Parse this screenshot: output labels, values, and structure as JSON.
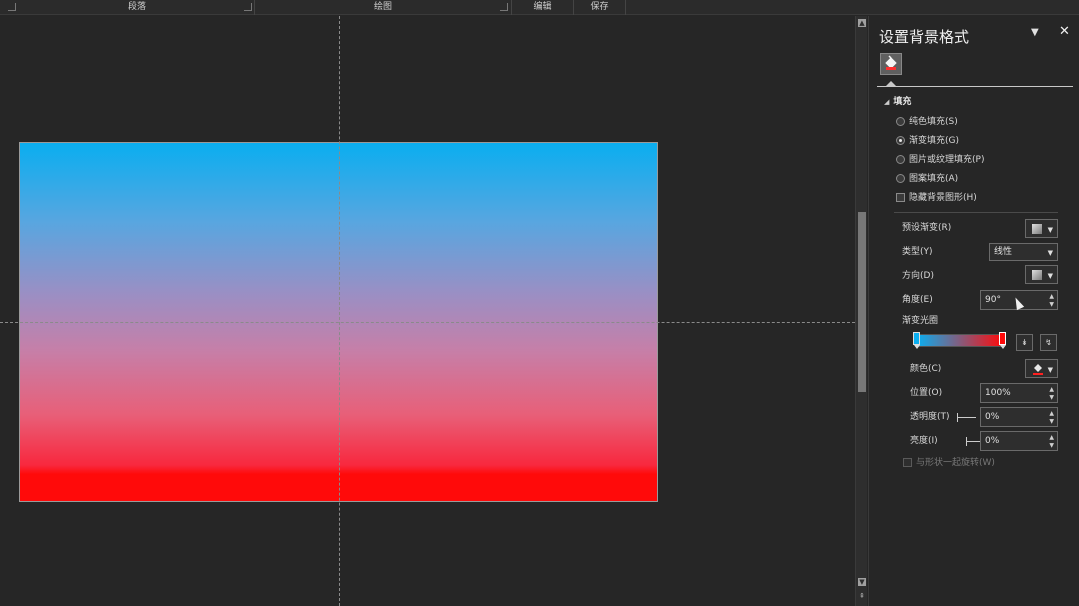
{
  "ribbon": {
    "groups": [
      "段落",
      "绘图",
      "编辑",
      "保存"
    ]
  },
  "pane": {
    "title": "设置背景格式",
    "menu_icon": "dropdown-arrow-icon",
    "close_icon": "close-icon",
    "tab_icon": "paint-bucket-icon",
    "section": "填充",
    "fill_options": [
      {
        "label": "纯色填充(S)",
        "selected": false
      },
      {
        "label": "渐变填充(G)",
        "selected": true
      },
      {
        "label": "图片或纹理填充(P)",
        "selected": false
      },
      {
        "label": "图案填充(A)",
        "selected": false
      }
    ],
    "hide_bg_graphics": "隐藏背景图形(H)",
    "preset_gradient": "预设渐变(R)",
    "type_label": "类型(Y)",
    "type_value": "线性",
    "direction_label": "方向(D)",
    "angle_label": "角度(E)",
    "angle_value": "90°",
    "gradient_stops_label": "渐变光圈",
    "color_label": "颜色(C)",
    "position_label": "位置(O)",
    "position_value": "100%",
    "transparency_label": "透明度(T)",
    "transparency_value": "0%",
    "brightness_label": "亮度(I)",
    "brightness_value": "0%",
    "rotate_with_shape": "与形状一起旋转(W)"
  },
  "colors": {
    "gradient_start": "#0aaef0",
    "gradient_end": "#ff0a0a"
  }
}
